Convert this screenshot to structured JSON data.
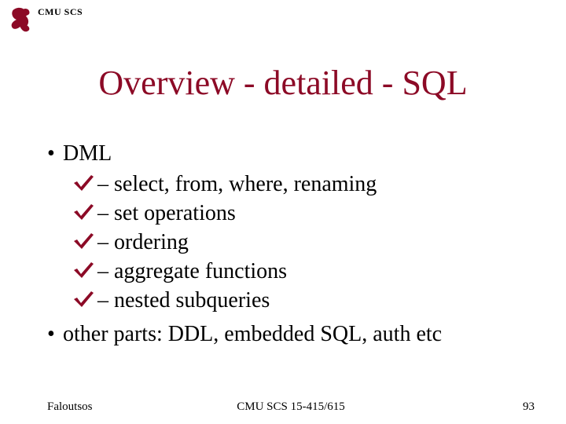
{
  "header": {
    "org": "CMU SCS"
  },
  "title": "Overview - detailed - SQL",
  "bullets": {
    "dml": "DML",
    "items": [
      "select, from, where, renaming",
      "set operations",
      "ordering",
      "aggregate functions",
      "nested subqueries"
    ],
    "other": "other parts: DDL, embedded SQL, auth etc"
  },
  "footer": {
    "left": "Faloutsos",
    "center": "CMU SCS 15-415/615",
    "right": "93"
  },
  "colors": {
    "accent": "#8c0a26"
  }
}
